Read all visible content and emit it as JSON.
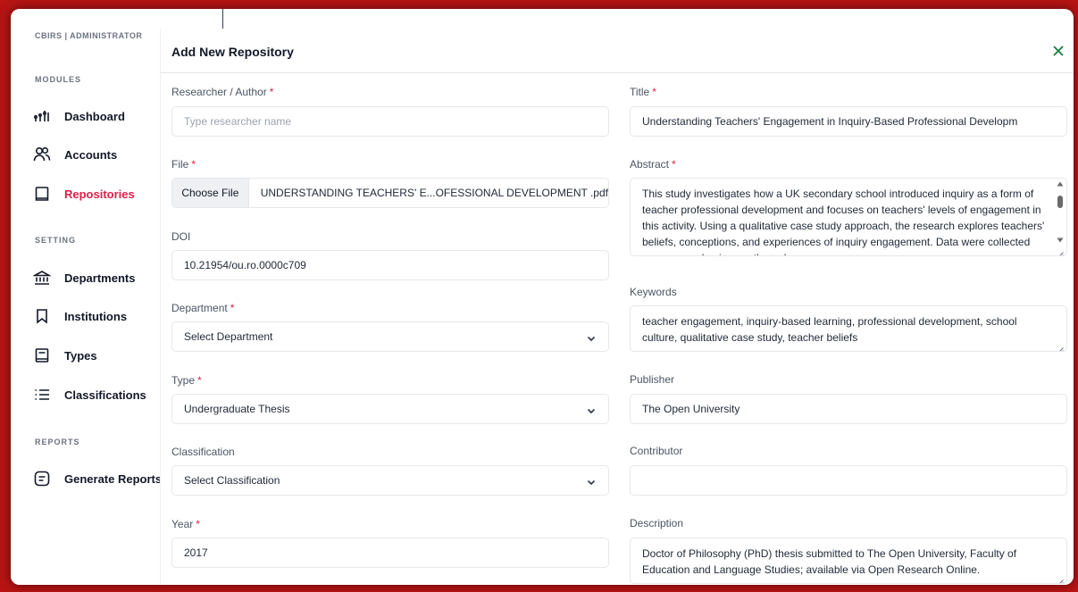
{
  "sidebar": {
    "brand": "CBIRS | ADMINISTRATOR",
    "sections": {
      "modules": "MODULES",
      "setting": "SETTING",
      "reports": "REPORTS"
    },
    "items": [
      {
        "label": "Dashboard",
        "icon": "dashboard-icon"
      },
      {
        "label": "Accounts",
        "icon": "users-icon"
      },
      {
        "label": "Repositories",
        "icon": "repository-icon",
        "active": true
      },
      {
        "label": "Departments",
        "icon": "bank-icon"
      },
      {
        "label": "Institutions",
        "icon": "bookmark-icon"
      },
      {
        "label": "Types",
        "icon": "book-icon"
      },
      {
        "label": "Classifications",
        "icon": "list-icon"
      },
      {
        "label": "Generate Reports",
        "icon": "report-icon"
      }
    ],
    "active_color": "#e11d48"
  },
  "modal": {
    "title": "Add New Repository",
    "close_icon": "close-icon",
    "left": {
      "researcher": {
        "label": "Researcher / Author",
        "required": "*",
        "placeholder": "Type researcher name",
        "value": ""
      },
      "file": {
        "label": "File",
        "required": "*",
        "button": "Choose File",
        "filename": "UNDERSTANDING TEACHERS' E...OFESSIONAL DEVELOPMENT .pdf"
      },
      "doi": {
        "label": "DOI",
        "value": "10.21954/ou.ro.0000c709"
      },
      "department": {
        "label": "Department",
        "required": "*",
        "value": "Select Department"
      },
      "type": {
        "label": "Type",
        "required": "*",
        "value": "Undergraduate Thesis"
      },
      "classification": {
        "label": "Classification",
        "value": "Select Classification"
      },
      "year": {
        "label": "Year",
        "required": "*",
        "value": "2017"
      }
    },
    "right": {
      "title": {
        "label": "Title",
        "required": "*",
        "value": "Understanding Teachers' Engagement in Inquiry-Based Professional Developm"
      },
      "abstract": {
        "label": "Abstract",
        "required": "*",
        "value": "This study investigates how a UK secondary school introduced inquiry as a form of teacher professional development and focuses on teachers' levels of engagement in this activity. Using a qualitative case study approach, the research explores teachers' beliefs, conceptions, and experiences of inquiry engagement. Data were collected over an academic year through"
      },
      "keywords": {
        "label": "Keywords",
        "value": "teacher engagement, inquiry-based learning, professional development, school culture, qualitative case study, teacher beliefs"
      },
      "publisher": {
        "label": "Publisher",
        "value": "The Open University"
      },
      "contributor": {
        "label": "Contributor",
        "value": ""
      },
      "description": {
        "label": "Description",
        "value": "Doctor of Philosophy (PhD) thesis submitted to The Open University, Faculty of Education and Language Studies; available via Open Research Online."
      }
    }
  }
}
